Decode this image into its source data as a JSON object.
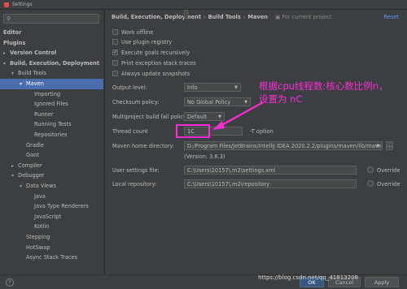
{
  "window": {
    "title": "Settings"
  },
  "sidebar": {
    "items": [
      {
        "label": "Editor",
        "bold": true
      },
      {
        "label": "Plugins",
        "bold": true
      },
      {
        "label": "Version Control",
        "bold": true,
        "arrow": "▸"
      },
      {
        "label": "Build, Execution, Deployment",
        "bold": true,
        "arrow": "▾"
      },
      {
        "label": "Build Tools",
        "arrow": "▾"
      },
      {
        "label": "Maven",
        "arrow": "▾",
        "selected": true
      },
      {
        "label": "Importing"
      },
      {
        "label": "Ignored Files"
      },
      {
        "label": "Runner"
      },
      {
        "label": "Running Tests"
      },
      {
        "label": "Repositories"
      },
      {
        "label": "Gradle"
      },
      {
        "label": "Gant"
      },
      {
        "label": "Compiler",
        "arrow": "▸"
      },
      {
        "label": "Debugger",
        "arrow": "▾"
      },
      {
        "label": "Data Views",
        "arrow": "▾"
      },
      {
        "label": "Java"
      },
      {
        "label": "Java Type Renderers"
      },
      {
        "label": "JavaScript"
      },
      {
        "label": "Kotlin"
      },
      {
        "label": "Stepping"
      },
      {
        "label": "HotSwap"
      },
      {
        "label": "Async Stack Traces"
      }
    ]
  },
  "header": {
    "breadcrumb": [
      "Build, Execution, Deployment",
      "Build Tools",
      "Maven"
    ],
    "scope": "For current project",
    "reset": "Reset"
  },
  "checkboxes": [
    {
      "label": "Work offline",
      "checked": false
    },
    {
      "label": "Use plugin registry",
      "checked": false
    },
    {
      "label": "Execute goals recursively",
      "checked": true
    },
    {
      "label": "Print exception stack traces",
      "checked": false
    },
    {
      "label": "Always update snapshots",
      "checked": false
    }
  ],
  "fields": {
    "output_level": {
      "label": "Output level:",
      "value": "Info"
    },
    "checksum_policy": {
      "label": "Checksum policy:",
      "value": "No Global Policy"
    },
    "fail_policy": {
      "label": "Multiproject build fail policy:",
      "value": "Default"
    },
    "thread_count": {
      "label": "Thread count",
      "value": "1C",
      "hint": "-T option"
    },
    "maven_home": {
      "label": "Maven home directory:",
      "value": "D:/Program Files/JetBrains/IntelliJ IDEA 2020.2.2/plugins/maven/lib/maven3",
      "version": "(Version: 3.6.3)"
    },
    "user_settings": {
      "label": "User settings file:",
      "value": "C:\\Users\\10157\\.m2\\settings.xml",
      "override": "Override"
    },
    "local_repo": {
      "label": "Local repository:",
      "value": "C:\\Users\\10157\\.m2\\repository",
      "override": "Override"
    }
  },
  "annotation": {
    "line1": "根据cpu线程数:核心数比例n，",
    "line2": "设置为 nC"
  },
  "footer": {
    "ok": "OK",
    "cancel": "Cancel",
    "apply": "Apply",
    "watermark": "https://blog.csdn.net/qq_41813208"
  },
  "colors": {
    "selection": "#4b6eaf",
    "annotation": "#ff2bd8",
    "link": "#589df6"
  }
}
